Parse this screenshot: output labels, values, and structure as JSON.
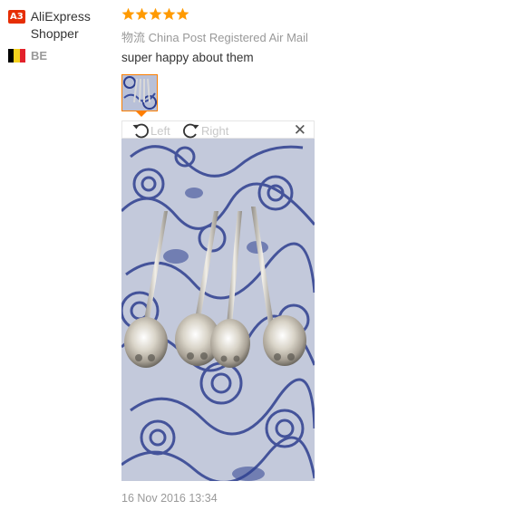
{
  "reviewer": {
    "level_badge": "A3",
    "name": "AliExpress Shopper",
    "country_code": "BE",
    "flag_colors": [
      "#000000",
      "#f5d11e",
      "#e3222b"
    ]
  },
  "review": {
    "rating": 5,
    "rating_max": 5,
    "star_color": "#ff9a00",
    "shipping_prefix": "物流",
    "shipping_method": "China Post Registered Air Mail",
    "text": "super happy about them",
    "date": "16 Nov 2016 13:34"
  },
  "viewer": {
    "rotate_left_label": "Left",
    "rotate_right_label": "Right",
    "close_icon": "close-icon"
  },
  "colors": {
    "accent": "#ff7e00",
    "badge": "#e62e04",
    "muted_text": "#999999",
    "paisley_blue": "#2e3f8f",
    "paisley_bg": "#c1c8da"
  }
}
